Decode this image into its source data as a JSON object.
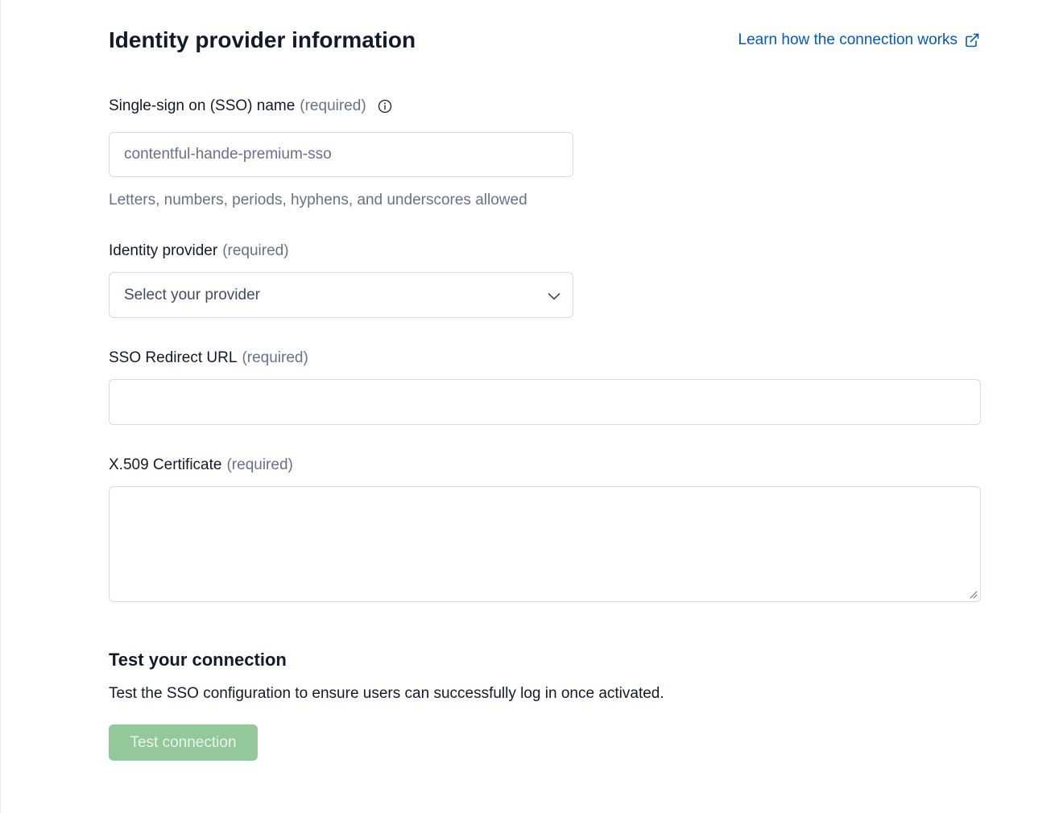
{
  "header": {
    "title": "Identity provider information",
    "learn_link": "Learn how the connection works"
  },
  "sso_name": {
    "label": "Single-sign on (SSO) name",
    "required": "(required)",
    "placeholder": "contentful-hande-premium-sso",
    "help": "Letters, numbers, periods, hyphens, and underscores allowed"
  },
  "identity_provider": {
    "label": "Identity provider",
    "required": "(required)",
    "selected": "Select your provider"
  },
  "redirect_url": {
    "label": "SSO Redirect URL",
    "required": "(required)",
    "value": ""
  },
  "certificate": {
    "label": "X.509 Certificate",
    "required": "(required)",
    "value": ""
  },
  "test": {
    "title": "Test your connection",
    "description": "Test the SSO configuration to ensure users can successfully log in once activated.",
    "button_label": "Test connection"
  },
  "colors": {
    "link": "#0059c8",
    "button_disabled_bg": "#93c89b",
    "muted_text": "#67728a",
    "border": "#d3dce0"
  },
  "icons": {
    "external_link": "external-link-icon",
    "info": "info-icon",
    "chevron": "chevron-down-icon"
  }
}
